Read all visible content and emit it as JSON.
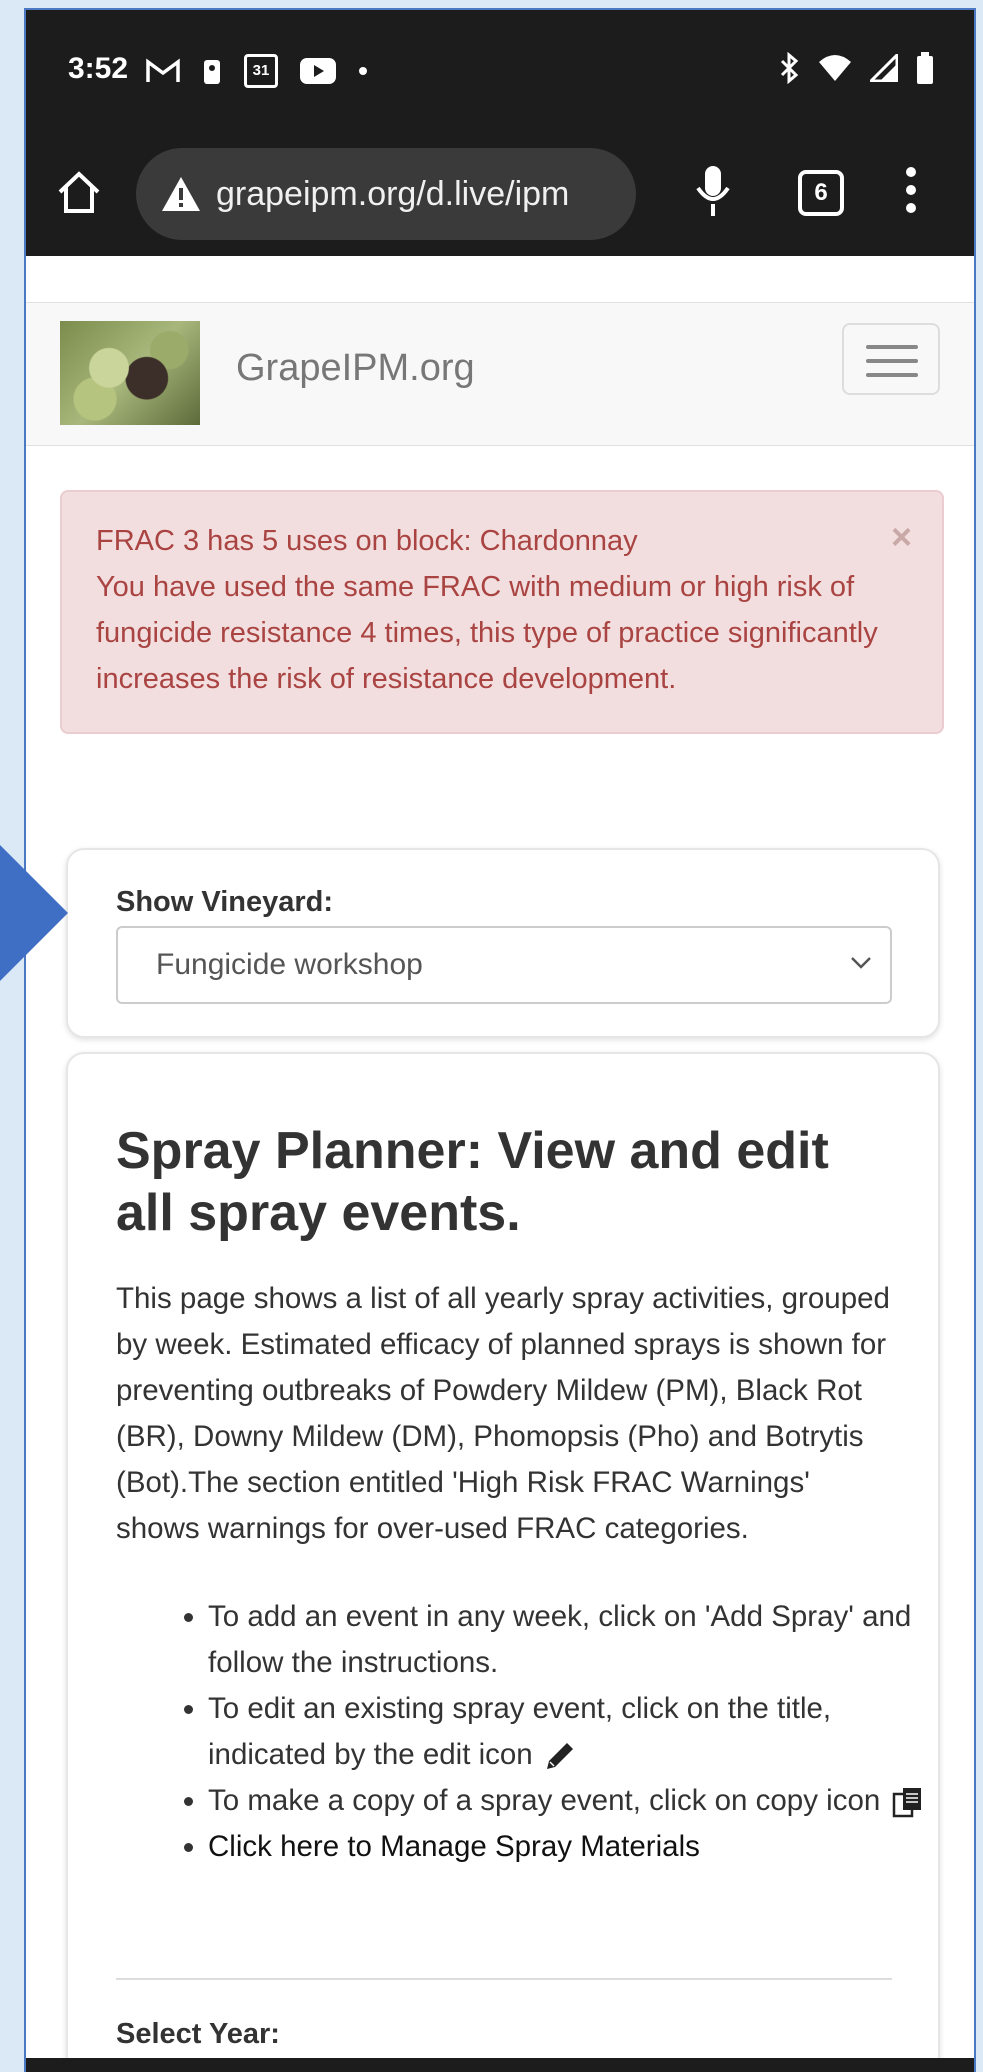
{
  "status_bar": {
    "time": "3:52",
    "left_icons": [
      "gmail-icon",
      "notification-icon",
      "calendar-icon",
      "youtube-icon",
      "dot-icon"
    ],
    "calendar_day": "31",
    "right_icons": [
      "bluetooth-icon",
      "wifi-icon",
      "signal-icon",
      "battery-icon"
    ]
  },
  "browser": {
    "url": "grapeipm.org/d.live/ipm",
    "tab_count": "6"
  },
  "site_nav": {
    "brand": "GrapeIPM.org"
  },
  "alert": {
    "line1": "FRAC 3 has 5 uses on block: Chardonnay",
    "line2": "You have used the same FRAC with medium or high risk of fungicide resistance 4 times, this type of practice significantly increases the risk of resistance development.",
    "close_label": "×"
  },
  "vineyard": {
    "label": "Show Vineyard:",
    "selected": "Fungicide workshop"
  },
  "planner": {
    "title": "Spray Planner: View and edit all spray events.",
    "description": "This page shows a list of all yearly spray activities, grouped by week. Estimated efficacy of planned sprays is shown for preventing outbreaks of Powdery Mildew (PM), Black Rot (BR), Downy Mildew (DM), Phomopsis (Pho) and Botrytis (Bot).The section entitled 'High Risk FRAC Warnings' shows warnings for over-used FRAC categories.",
    "bullets": {
      "add": "To add an event in any week, click on 'Add Spray' and follow the instructions.",
      "edit": "To edit an existing spray event, click on the title, indicated by the edit icon",
      "copy": "To make a copy of a spray event, click on copy icon",
      "manage_link": "Click here to Manage Spray Materials"
    },
    "year_label": "Select Year:"
  }
}
